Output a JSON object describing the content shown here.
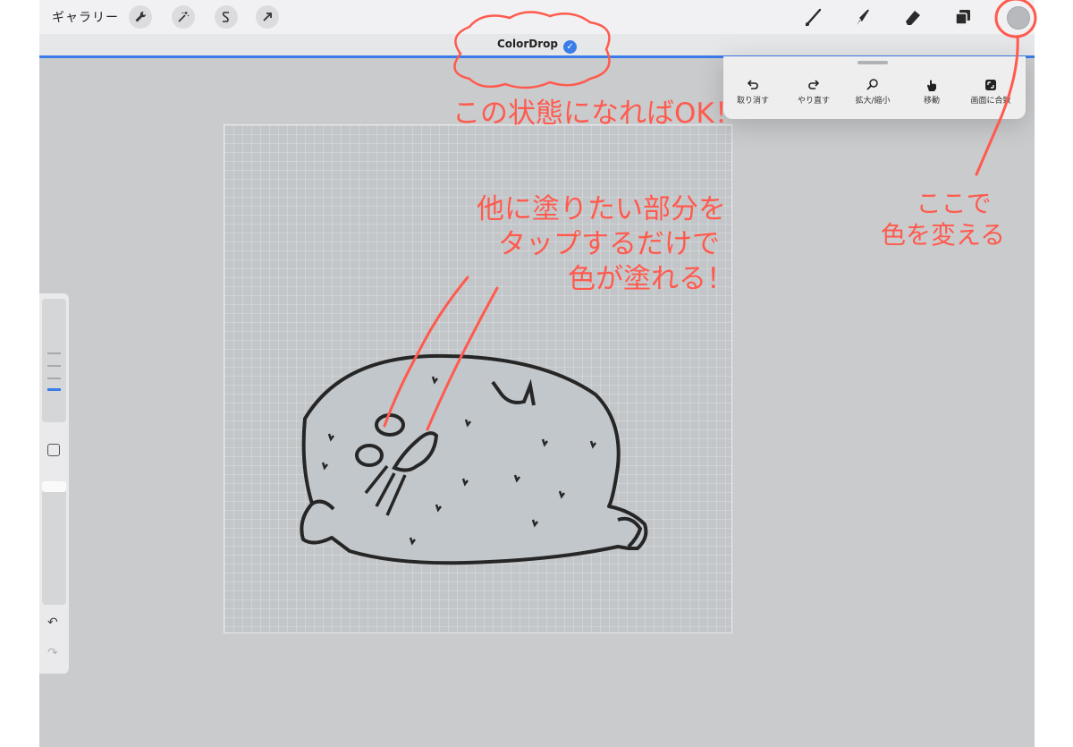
{
  "topbar": {
    "gallery_label": "ギャラリー",
    "left_tools": [
      "wrench-icon",
      "magic-wand-icon",
      "selection-s-icon",
      "transform-arrow-icon"
    ],
    "right_tools": [
      "brush-icon",
      "smudge-icon",
      "eraser-icon",
      "layers-icon"
    ],
    "current_color": "#b7b9bc"
  },
  "document": {
    "title": "ColorDrop",
    "title_check": "✓",
    "accent": "#3a7ce8"
  },
  "quick_menu": {
    "items": [
      {
        "label": "取り消す",
        "icon": "undo-icon"
      },
      {
        "label": "やり直す",
        "icon": "redo-icon"
      },
      {
        "label": "拡大/縮小",
        "icon": "zoom-icon"
      },
      {
        "label": "移動",
        "icon": "hand-icon"
      },
      {
        "label": "画面に合致",
        "icon": "fit-screen-icon"
      }
    ]
  },
  "sidebar": {
    "undo_label": "↶",
    "redo_label": "↷"
  },
  "annotations": {
    "note_ok": "この状態になればOK！",
    "note_tap": [
      "他に塗りたい部分を",
      "タップするだけで",
      "色が塗れる！"
    ],
    "note_color": [
      "ここで",
      "色を変える"
    ],
    "color": "#ff5a4e"
  }
}
